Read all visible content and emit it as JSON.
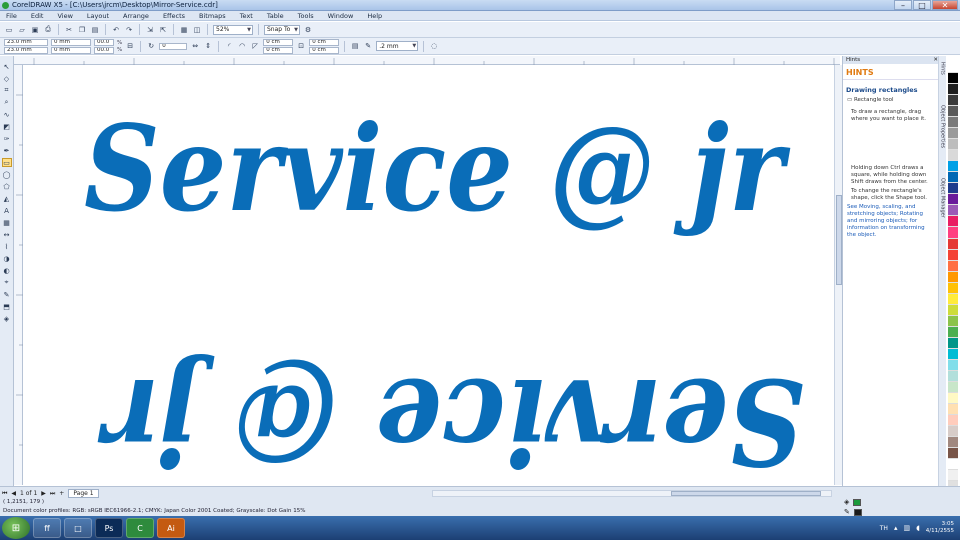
{
  "window": {
    "title": "CorelDRAW X5 - [C:\\Users\\jrcm\\Desktop\\Mirror-Service.cdr]",
    "buttons": {
      "minimize": "–",
      "maximize": "□",
      "close": "✕"
    }
  },
  "menu": [
    "File",
    "Edit",
    "View",
    "Layout",
    "Arrange",
    "Effects",
    "Bitmaps",
    "Text",
    "Table",
    "Tools",
    "Window",
    "Help"
  ],
  "toolbar": {
    "zoom_value": "52%",
    "snap_label": "Snap To",
    "icons": {
      "new": "new-icon",
      "open": "open-icon",
      "save": "save-icon",
      "print": "print-icon",
      "cut": "cut-icon",
      "copy": "copy-icon",
      "paste": "paste-icon",
      "undo": "undo-icon",
      "redo": "redo-icon",
      "import": "import-icon",
      "export": "export-icon"
    }
  },
  "property_bar": {
    "x_value": "23.0 mm",
    "y_value": "23.0 mm",
    "width_value": "0 mm",
    "height_value": "0 mm",
    "scale_x": "00.0",
    "scale_y": "00.0",
    "scale_unit": "%",
    "rotation_value": "0",
    "corner_a": "0 cm",
    "corner_b": "0 cm",
    "corner_c": "0 cm",
    "corner_d": "0 cm",
    "outline_width": ".2 mm"
  },
  "canvas": {
    "text_top": "Service @ jr",
    "text_bottom": "Service @ jr",
    "text_color": "#0a6db8"
  },
  "docker": {
    "header": "Hints",
    "title": "HINTS",
    "subtitle": "Drawing rectangles",
    "tool_label": "Rectangle tool",
    "line1": "To draw a rectangle, drag where you want to place it.",
    "line2": "Holding down Ctrl draws a square, while holding down Shift draws from the center.",
    "line3": "To change the rectangle's shape, click the Shape tool.",
    "line4": "See Moving, scaling, and stretching objects; Rotating and mirroring objects; for information on transforming the object."
  },
  "side_tabs": [
    "Hints",
    "Object Properties",
    "Object Manager"
  ],
  "palette_colors": [
    "#ffffff",
    "#000000",
    "#1f1f1f",
    "#3b3b3b",
    "#5a5a5a",
    "#7a7a7a",
    "#9a9a9a",
    "#bdbdbd",
    "#d9d9d9",
    "#00a0e6",
    "#0068b4",
    "#1e3c8c",
    "#6a1b9a",
    "#9b59b6",
    "#e91e63",
    "#ff4081",
    "#e53935",
    "#f44336",
    "#ff7043",
    "#ff9800",
    "#ffc107",
    "#ffeb3b",
    "#cddc39",
    "#8bc34a",
    "#4caf50",
    "#009688",
    "#00bcd4",
    "#80deea",
    "#b2dfdb",
    "#c8e6c9",
    "#fff9c4",
    "#ffe0b2",
    "#ffccbc",
    "#d7ccc8",
    "#a1887f",
    "#795548",
    "#ffffff",
    "#f0f0f0",
    "#e0e0e0"
  ],
  "page": {
    "counter": "1 of 1",
    "tab": "Page 1"
  },
  "status": {
    "coords": "( 1,2151, 179 )",
    "object_info": "Document color profiles: RGB: sRGB IEC61966-2.1; CMYK: Japan Color 2001 Coated; Grayscale: Dot Gain 15%",
    "fill_color": "#1a9a3a",
    "outline_color": "#1a1a1a"
  },
  "taskbar": {
    "apps": [
      {
        "name": "firefox",
        "label": "ff"
      },
      {
        "name": "explorer",
        "label": "□"
      },
      {
        "name": "photoshop",
        "label": "Ps"
      },
      {
        "name": "coreldraw",
        "label": "C"
      },
      {
        "name": "illustrator",
        "label": "Ai"
      }
    ],
    "tray_lang": "TH",
    "time": "3:05",
    "date": "4/11/2555"
  }
}
